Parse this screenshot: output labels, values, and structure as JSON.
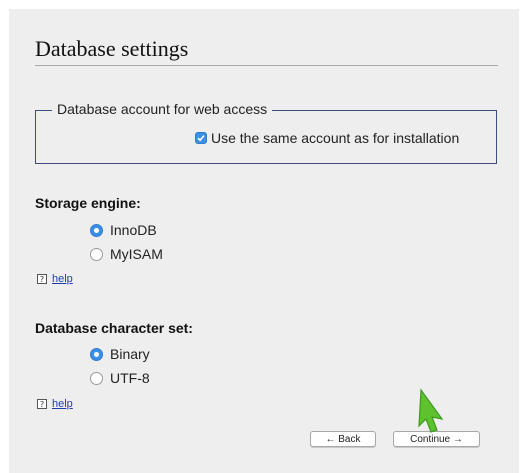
{
  "page": {
    "title": "Database settings"
  },
  "web_access": {
    "legend": "Database account for web access",
    "same_account_label": "Use the same account as for installation",
    "same_account_checked": true
  },
  "storage_engine": {
    "label": "Storage engine:",
    "options": [
      {
        "label": "InnoDB",
        "selected": true
      },
      {
        "label": "MyISAM",
        "selected": false
      }
    ],
    "help_icon": "?",
    "help_text": "help"
  },
  "charset": {
    "label": "Database character set:",
    "options": [
      {
        "label": "Binary",
        "selected": true
      },
      {
        "label": "UTF-8",
        "selected": false
      }
    ],
    "help_icon": "?",
    "help_text": "help"
  },
  "buttons": {
    "back_label": "← Back",
    "continue_label": "Continue →"
  },
  "colors": {
    "accent": "#3a8fe8",
    "cursor": "#5ec22f",
    "link": "#1d3fae"
  },
  "icons": {
    "checkbox": "checkmark-icon",
    "help": "question-icon",
    "pointer": "arrow-cursor-icon"
  }
}
